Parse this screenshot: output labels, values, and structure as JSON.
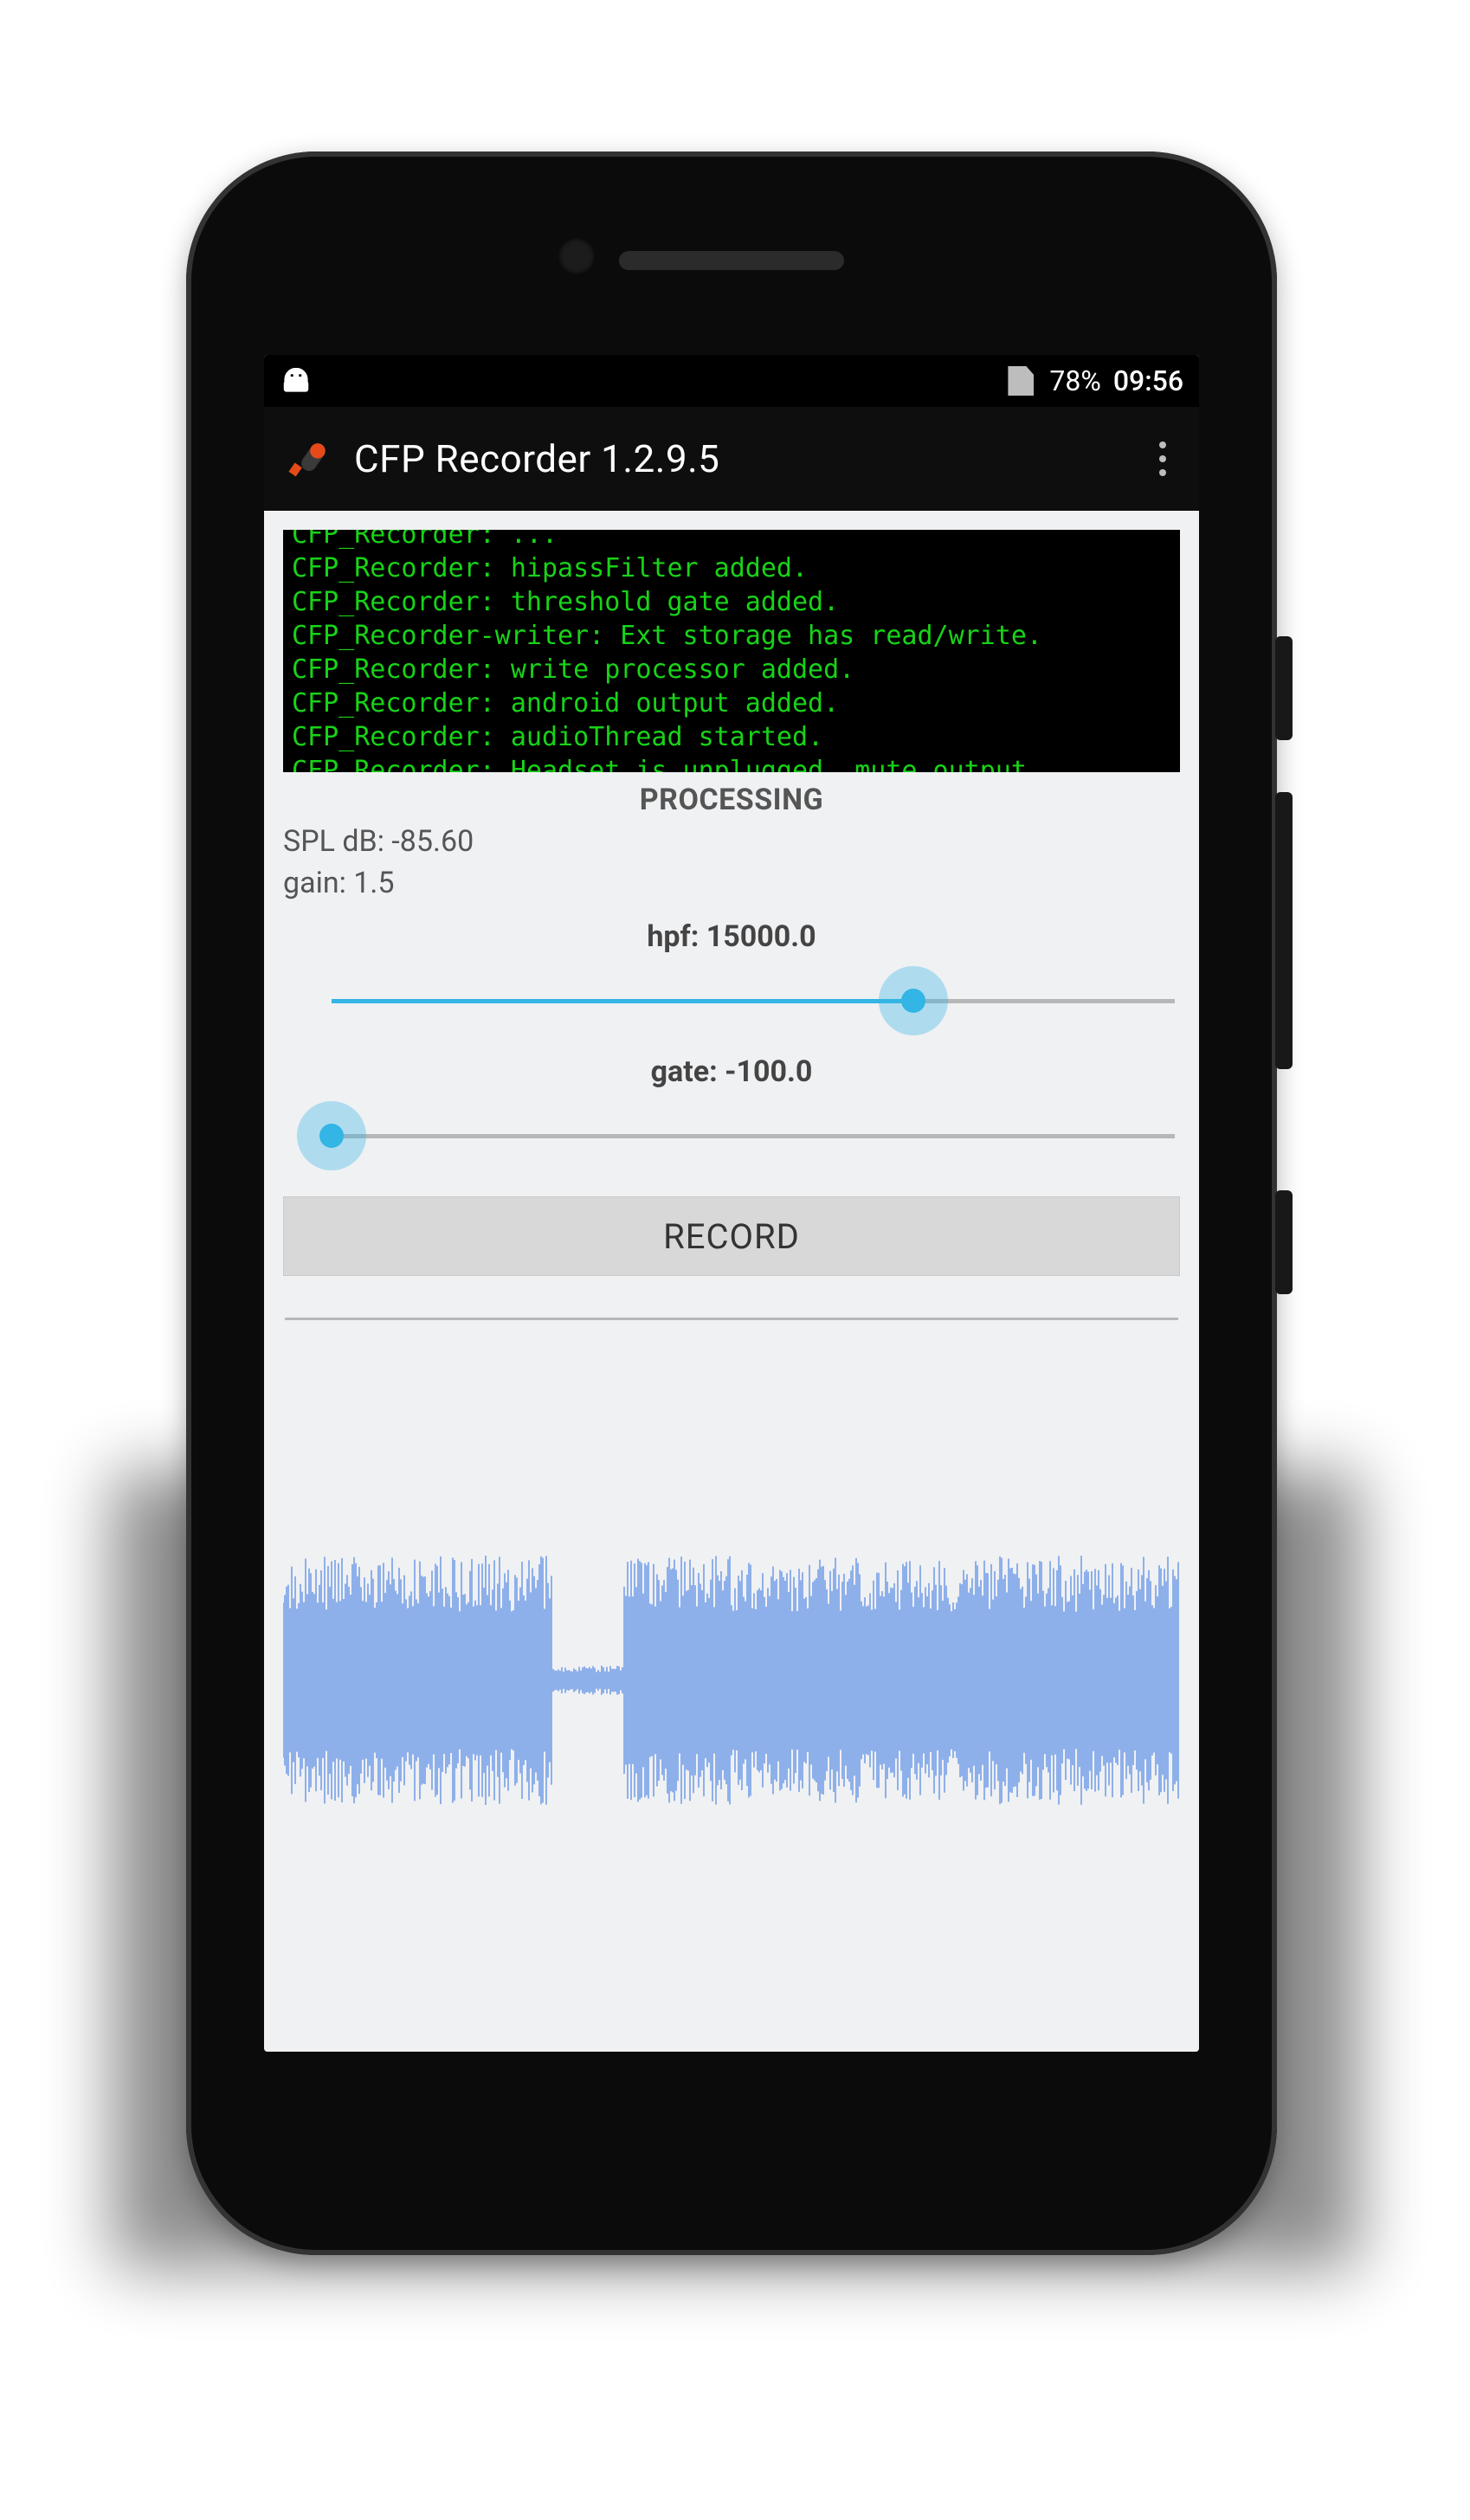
{
  "statusbar": {
    "battery": "78%",
    "time": "09:56"
  },
  "appbar": {
    "title": "CFP Recorder 1.2.9.5"
  },
  "console_lines": [
    "CFP_Recorder: hipassFilter added.",
    "CFP_Recorder: threshold gate added.",
    "CFP_Recorder-writer: Ext storage has read/write.",
    "CFP_Recorder: write processor added.",
    "CFP_Recorder: android output added.",
    "CFP_Recorder: audioThread started.",
    "CFP_Recorder: Headset is unplugged, mute output"
  ],
  "section": "PROCESSING",
  "metrics": {
    "spl": "SPL dB: -85.60",
    "gain": "gain: 1.5"
  },
  "sliders": {
    "hpf": {
      "label": "hpf: 15000.0",
      "pct": 72
    },
    "gate": {
      "label": "gate: -100.0",
      "pct": 0
    }
  },
  "record": "RECORD"
}
